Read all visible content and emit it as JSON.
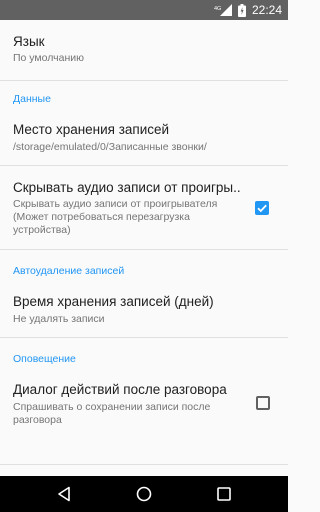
{
  "status_bar": {
    "network": "4G",
    "time": "22:24"
  },
  "preferences": {
    "language": {
      "title": "Язык",
      "summary": "По умолчанию"
    },
    "category_data": "Данные",
    "storage_location": {
      "title": "Место хранения записей",
      "summary": "/storage/emulated/0/Записанные звонки/"
    },
    "hide_audio": {
      "title": "Скрывать аудио записи от проигры..",
      "summary_line1": "Скрывать аудио записи от проигрывателя",
      "summary_line2": "(Может потребоваться перезагрузка",
      "summary_line3": "устройства)",
      "checked": true
    },
    "category_autodelete": "Автоудаление записей",
    "retention_time": {
      "title": "Время хранения записей (дней)",
      "summary": "Не удалять записи"
    },
    "category_notification": "Оповещение",
    "after_call_dialog": {
      "title": "Диалог действий после разговора",
      "summary_line1": "Спрашивать о сохранении записи после",
      "summary_line2": "разговора",
      "checked": false
    }
  },
  "icons": {
    "back": "back-icon",
    "home": "home-icon",
    "recents": "recents-icon",
    "checkbox_checked": "checkbox-checked-icon",
    "checkbox_unchecked": "checkbox-unchecked-icon"
  },
  "colors": {
    "accent": "#2196f3",
    "status_bar": "#616161",
    "nav_bar": "#000000"
  }
}
